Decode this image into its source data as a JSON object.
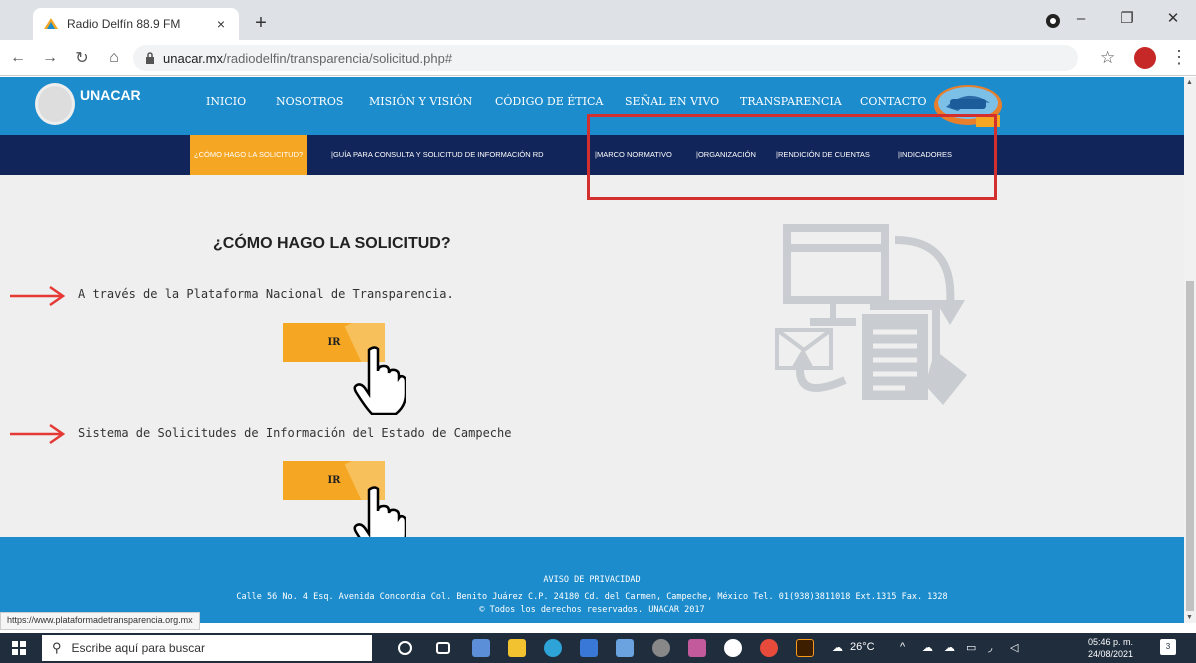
{
  "browser": {
    "tab_title": "Radio Delfín 88.9 FM",
    "tab_close": "×",
    "new_tab": "+",
    "url_host": "unacar.mx",
    "url_path": "/radiodelfin/transparencia/solicitud.php#",
    "status_url": "https://www.plataformadetransparencia.org.mx"
  },
  "site": {
    "logo_text": "UNACAR",
    "nav": [
      "INICIO",
      "NOSOTROS",
      "MISIÓN Y VISIÓN",
      "CÓDIGO DE ÉTICA",
      "SEÑAL EN VIVO",
      "TRANSPARENCIA",
      "CONTACTO"
    ],
    "subnav": [
      "¿CÓMO HAGO LA SOLICITUD?",
      "|GUÍA PARA CONSULTA Y SOLICITUD DE INFORMACIÓN RD",
      "|MARCO NORMATIVO",
      "|ORGANIZACIÓN",
      "|RENDICIÓN DE CUENTAS",
      "|INDICADORES"
    ]
  },
  "content": {
    "title": "¿CÓMO HAGO LA SOLICITUD?",
    "option1": "A través de la Plataforma Nacional de Transparencia.",
    "option2": "Sistema de Solicitudes de Información del Estado de Campeche",
    "button_label": "IR"
  },
  "footer": {
    "line1": "AVISO DE PRIVACIDAD",
    "line2": "Calle 56 No. 4 Esq. Avenida Concordia Col. Benito Juárez C.P. 24180 Cd. del Carmen, Campeche, México Tel. 01(938)3811018 Ext.1315 Fax. 1328",
    "line3": "© Todos los derechos reservados. UNACAR 2017"
  },
  "taskbar": {
    "search_placeholder": "Escribe aquí para buscar",
    "temperature": "26°C",
    "time": "05:46 p. m.",
    "date": "24/08/2021",
    "notifications": "3"
  },
  "colors": {
    "nav_blue": "#1d8ccc",
    "subnav_navy": "#12255a",
    "accent_orange": "#f5a623",
    "highlight_red": "#d32f2f"
  }
}
